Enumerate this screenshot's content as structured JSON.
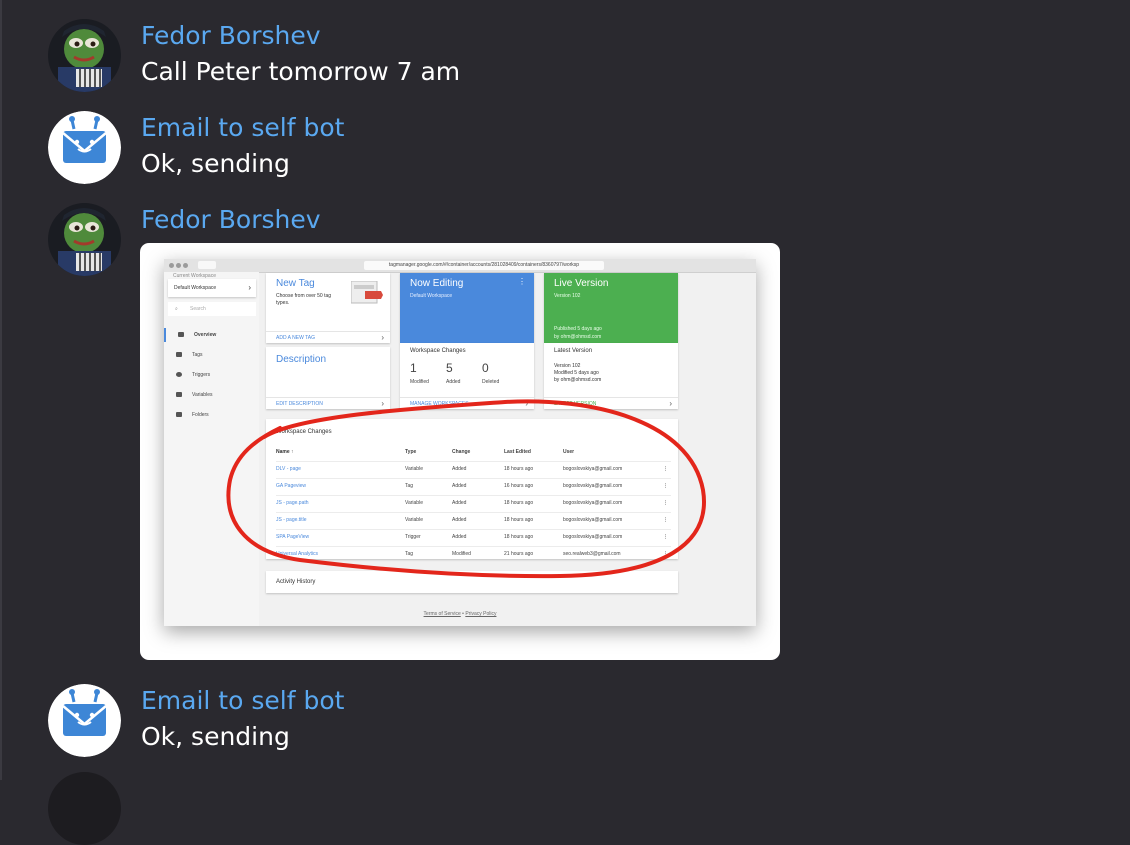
{
  "colors": {
    "background": "#2a292f",
    "sender_name": "#5aa8f0",
    "message_text": "#ffffff",
    "annotation_red": "#e3261b",
    "gtm_blue": "#4a89dc",
    "gtm_green": "#4caf50"
  },
  "messages": [
    {
      "sender": "Fedor Borshev",
      "avatar": "frog-avatar-icon",
      "text": "Call Peter tomorrow 7 am"
    },
    {
      "sender": "Email to self bot",
      "avatar": "robot-envelope-icon",
      "text": "Ok, sending"
    },
    {
      "sender": "Fedor Borshev",
      "avatar": "frog-avatar-icon",
      "text": ""
    },
    {
      "sender": "Email to self bot",
      "avatar": "robot-envelope-icon",
      "text": "Ok, sending"
    }
  ],
  "screenshot": {
    "url": "tagmanager.google.com/#/container/accounts/281028409/containers/8360797/worksp",
    "sidebar": {
      "current_workspace_label": "Current Workspace",
      "workspace": "Default Workspace",
      "search_placeholder": "Search",
      "nav": [
        "Overview",
        "Tags",
        "Triggers",
        "Variables",
        "Folders"
      ]
    },
    "new_tag": {
      "title": "New Tag",
      "desc_line1": "Choose from over 50 tag",
      "desc_line2": "types.",
      "action": "ADD A NEW TAG"
    },
    "now_editing": {
      "title": "Now Editing",
      "subtitle": "Default Workspace"
    },
    "live_version": {
      "title": "Live Version",
      "subtitle": "Version 102",
      "published": "Published 5 days ago",
      "by": "by ohm@ohmsd.com"
    },
    "description": {
      "title": "Description",
      "action": "EDIT DESCRIPTION"
    },
    "workspace_changes_card": {
      "title": "Workspace Changes",
      "stats": [
        {
          "value": "1",
          "label": "Modified"
        },
        {
          "value": "5",
          "label": "Added"
        },
        {
          "value": "0",
          "label": "Deleted"
        }
      ],
      "action": "MANAGE WORKSPACES"
    },
    "latest_version": {
      "title": "Latest Version",
      "line1": "Version 102",
      "line2": "Modified 5 days ago",
      "line3": "by ohm@ohmsd.com",
      "action": "LATEST VERSION"
    },
    "changes_table": {
      "title": "Workspace Changes",
      "headers": {
        "name": "Name ↑",
        "type": "Type",
        "change": "Change",
        "edited": "Last Edited",
        "user": "User"
      },
      "rows": [
        {
          "name": "DLV - page",
          "type": "Variable",
          "change": "Added",
          "edited": "18 hours ago",
          "user": "bogoslovskiya@gmail.com"
        },
        {
          "name": "GA Pageview",
          "type": "Tag",
          "change": "Added",
          "edited": "16 hours ago",
          "user": "bogoslovskiya@gmail.com"
        },
        {
          "name": "JS - page.path",
          "type": "Variable",
          "change": "Added",
          "edited": "18 hours ago",
          "user": "bogoslovskiya@gmail.com"
        },
        {
          "name": "JS - page.title",
          "type": "Variable",
          "change": "Added",
          "edited": "18 hours ago",
          "user": "bogoslovskiya@gmail.com"
        },
        {
          "name": "SPA PageView",
          "type": "Trigger",
          "change": "Added",
          "edited": "18 hours ago",
          "user": "bogoslovskiya@gmail.com"
        },
        {
          "name": "Universal Analytics",
          "type": "Tag",
          "change": "Modified",
          "edited": "21 hours ago",
          "user": "seo.realweb3@gmail.com"
        }
      ],
      "row_menu": "⋮"
    },
    "activity_history": "Activity History",
    "footer": {
      "terms": "Terms of Service",
      "sep": "•",
      "privacy": "Privacy Policy"
    }
  }
}
